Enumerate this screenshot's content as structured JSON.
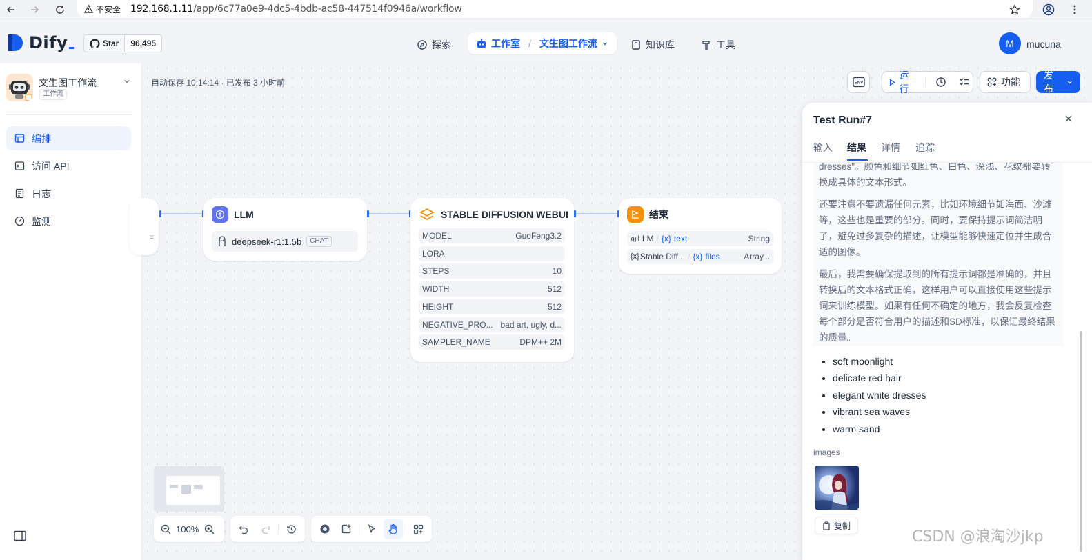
{
  "browser": {
    "insecure_label": "不安全",
    "url_host": "192.168.1.11",
    "url_path": "/app/6c77a0e9-4dc5-4bdb-ac58-447514f0946a/workflow"
  },
  "header": {
    "logo_text": "Dify",
    "github_star_label": "Star",
    "github_star_count": "96,495",
    "nav_explore": "探索",
    "nav_studio": "工作室",
    "nav_current_app": "文生图工作流",
    "nav_knowledge": "知识库",
    "nav_tools": "工具",
    "avatar_initial": "M",
    "username": "mucuna"
  },
  "sidebar": {
    "app_name": "文生图工作流",
    "app_type": "工作流",
    "items": [
      {
        "label": "编排",
        "icon": "layout-icon",
        "active": true
      },
      {
        "label": "访问 API",
        "icon": "terminal-icon",
        "active": false
      },
      {
        "label": "日志",
        "icon": "file-list-icon",
        "active": false
      },
      {
        "label": "监测",
        "icon": "dashboard-icon",
        "active": false
      }
    ]
  },
  "canvas": {
    "autosave_text": "自动保存 10:14:14 · 已发布 3 小时前",
    "zoom_level": "100%",
    "buttons": {
      "env": "ENV",
      "run": "运行",
      "features": "功能",
      "publish": "发布"
    },
    "nodes": {
      "llm": {
        "title": "LLM",
        "model": "deepseek-r1:1.5b",
        "mode": "CHAT"
      },
      "sd": {
        "title": "STABLE DIFFUSION WEBUI",
        "params": [
          {
            "key": "MODEL",
            "value": "GuoFeng3.2"
          },
          {
            "key": "LORA",
            "value": ""
          },
          {
            "key": "STEPS",
            "value": "10"
          },
          {
            "key": "WIDTH",
            "value": "512"
          },
          {
            "key": "HEIGHT",
            "value": "512"
          },
          {
            "key": "NEGATIVE_PRO...",
            "value": "bad art, ugly, d..."
          },
          {
            "key": "SAMPLER_NAME",
            "value": "DPM++ 2M"
          }
        ]
      },
      "end": {
        "title": "结束",
        "outputs": [
          {
            "source": "LLM",
            "var": "text",
            "type": "String"
          },
          {
            "source": "Stable Diff...",
            "var": "files",
            "type": "Array..."
          }
        ]
      }
    }
  },
  "panel": {
    "title": "Test Run#7",
    "tabs": [
      "输入",
      "结果",
      "详情",
      "追踪"
    ],
    "active_tab": "结果",
    "think_paragraphs": [
      "dresses\"。颜色和细节如红色、白色、深浅、花纹都要转换成具体的文本形式。",
      "还要注意不要遗漏任何元素，比如环境细节如海面、沙滩等，这些也是重要的部分。同时，要保持提示词简洁明了，避免过多复杂的描述，让模型能够快速定位并生成合适的图像。",
      "最后，我需要确保提取到的所有提示词都是准确的，并且转换后的文本格式正确，这样用户可以直接使用这些提示词来训练模型。如果有任何不确定的地方，我会反复检查每个部分是否符合用户的描述和SD标准，以保证最终结果的质量。"
    ],
    "bullets": [
      "soft moonlight",
      "delicate red hair",
      "elegant white dresses",
      "vibrant sea waves",
      "warm sand"
    ],
    "images_label": "images",
    "copy_label": "复制"
  },
  "watermark": "CSDN @浪淘沙jkp",
  "colors": {
    "primary": "#155eef",
    "llm_icon": "#6172f3",
    "sd_icon": "#f79009",
    "end_icon": "#f79009"
  }
}
